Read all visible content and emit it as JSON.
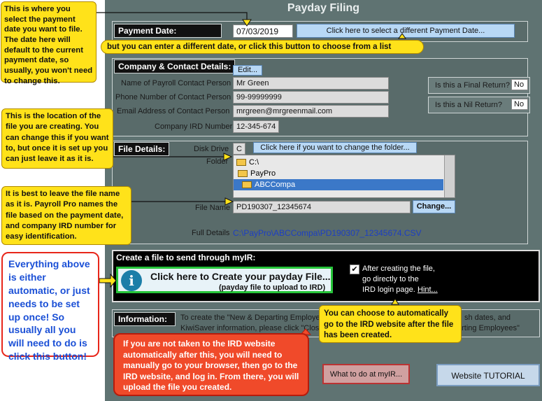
{
  "window": {
    "title": "Payday Filing"
  },
  "payment": {
    "label": "Payment Date:",
    "date": "07/03/2019",
    "select_button": "Click here to select a different Payment Date..."
  },
  "company": {
    "header": "Company & Contact Details:",
    "edit_button": "Edit...",
    "name_label": "Name of Payroll Contact Person",
    "name_value": "Mr Green",
    "phone_label": "Phone Number of Contact Person",
    "phone_value": "99-99999999",
    "email_label": "Email Address of Contact Person",
    "email_value": "mrgreen@mrgreenmail.com",
    "ird_label": "Company IRD Number",
    "ird_value": "12-345-674",
    "final_label": "Is this a Final Return?",
    "final_value": "No",
    "nil_label": "Is this a Nil Return?",
    "nil_value": "No"
  },
  "file": {
    "header": "File Details:",
    "disk_label": "Disk Drive",
    "disk_value": "C",
    "change_folder_button": "Click here if you want to change the folder...",
    "folder_label": "Folder",
    "folders": [
      "C:\\",
      "PayPro",
      "ABCCompa"
    ],
    "name_label": "File Name",
    "name_value": "PD190307_12345674",
    "change_button": "Change...",
    "full_label": "Full Details",
    "full_value": "C:\\PayPro\\ABCCompa\\PD190307_12345674.CSV"
  },
  "myir": {
    "header": "Create a file to send through myIR:",
    "create_main": "Click here to Create your payday File...",
    "create_sub": "(payday file to upload to IRD)",
    "after_text_1": "After creating the file,",
    "after_text_2": "go directly to the",
    "after_text_3": "IRD login page.",
    "hint_link": "Hint..."
  },
  "information": {
    "header": "Information:",
    "text_1": "To create the \"New & Departing Employe",
    "text_1b": "sh dates, and",
    "text_2": "KiwiSaver information, please click \"Clos",
    "text_2b": "arting Employees\""
  },
  "buttons": {
    "what_to_do": "What to do at myIR...",
    "tutorial": "Website TUTORIAL"
  },
  "callouts": {
    "payment_date": "This is where you select the payment date you want to file. The date here will default to the current payment date, so usually, you won't need to change this.",
    "enter_date": "but you can enter a different  date, or click this button to choose from a list",
    "location": "This is the location of the file you are creating. You can change this if you want to, but once it is set up you can just leave it as it is.",
    "file_name": "It is best to leave the file name as it is. Payroll Pro names the file based on the payment date, and company IRD number for easy identification.",
    "automatic": "Everything above is either automatic, or just needs to be set up once! So usually all you will need to do is click this button!",
    "auto_ird": "You can choose to automatically go to the IRD website after the file has been created.",
    "not_taken": "If you are not taken to the IRD website automatically after this, you will need to manually go to your browser, then go to the IRD website, and log in. From there, you will upload the file you created."
  },
  "colors": {
    "callout_yellow": "#ffe21a",
    "callout_red": "#f04a2a",
    "accent_blue": "#1a4fd6",
    "panel_bg": "#5f7372"
  }
}
